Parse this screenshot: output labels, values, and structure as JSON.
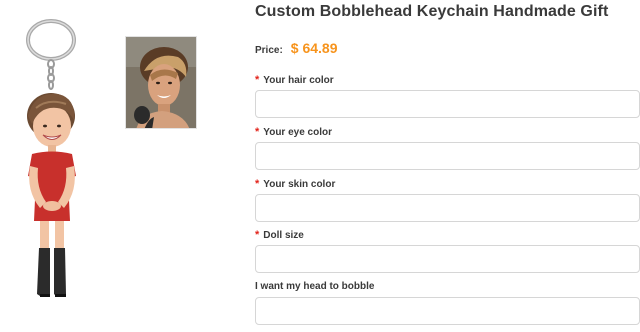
{
  "product": {
    "title": "Custom Bobblehead Keychain Handmade Gift",
    "price_label": "Price:",
    "price_value": "$ 64.89"
  },
  "colors": {
    "accent_price": "#f7941d",
    "required_marker": "#e2231a",
    "dress": "#c8302c"
  },
  "gallery": {
    "main_image": "bobblehead-keychain-figure",
    "thumbnail": "customer-photo-thumbnail"
  },
  "fields": [
    {
      "required_mark": "*",
      "label": "Your hair color",
      "value": ""
    },
    {
      "required_mark": "*",
      "label": "Your eye color",
      "value": ""
    },
    {
      "required_mark": "*",
      "label": "Your skin color",
      "value": ""
    },
    {
      "required_mark": "*",
      "label": "Doll size",
      "value": ""
    },
    {
      "required_mark": "",
      "label": "I want my head to bobble",
      "value": ""
    }
  ]
}
